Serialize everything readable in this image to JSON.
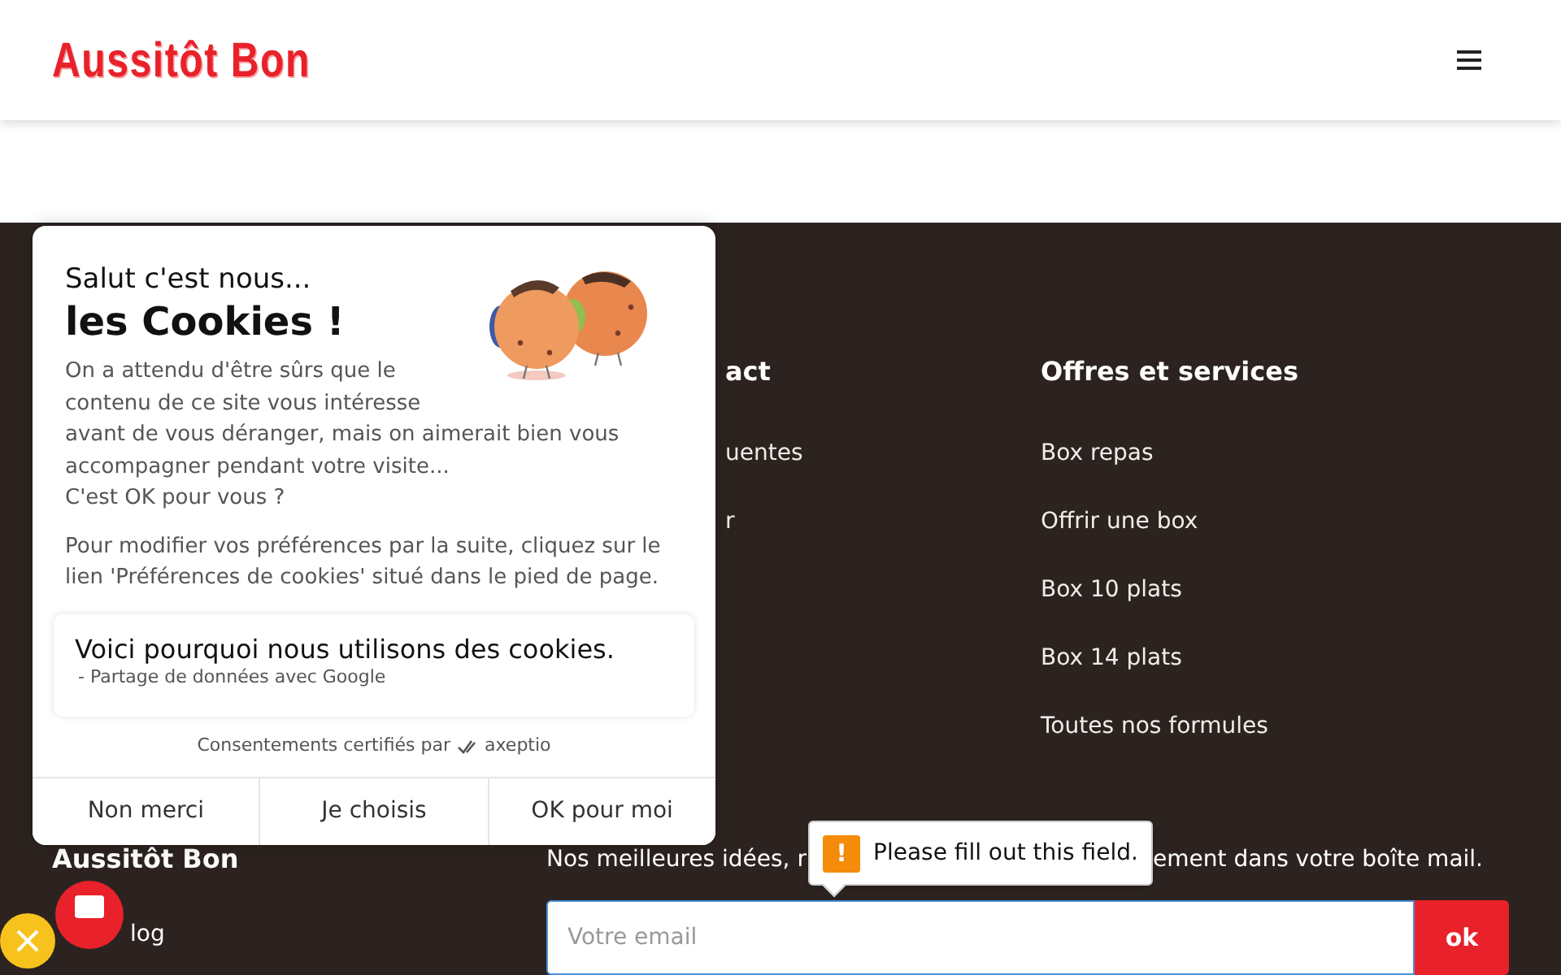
{
  "header": {
    "logo": "Aussitôt Bon"
  },
  "footer": {
    "columns": [
      {
        "heading": "act",
        "links": [
          "uentes",
          "r"
        ]
      },
      {
        "heading": "Offres et services",
        "links": [
          "Box repas",
          "Offrir une box",
          "Box 10 plats",
          "Box 14 plats",
          "Toutes nos formules"
        ]
      }
    ],
    "brand": "Aussitôt Bon",
    "brand_links": [
      "log"
    ],
    "newsletter": {
      "text_parts": [
        "Nos meilleures idées, r",
        "ement dans votre boîte mail."
      ],
      "placeholder": "Votre email",
      "button": "ok"
    }
  },
  "cookie_banner": {
    "greeting": "Salut c'est nous...",
    "title": "les Cookies !",
    "intro_lines": [
      "On a attendu d'être sûrs que le",
      "contenu de ce site vous intéresse",
      "avant de vous déranger, mais on aimerait bien vous",
      "accompagner pendant votre visite...",
      "C'est OK pour vous ?"
    ],
    "preferences_text": "Pour modifier vos préférences par la suite, cliquez sur le lien 'Préférences de cookies' situé dans le pied de page.",
    "purpose_card": {
      "title": "Voici pourquoi nous utilisons des cookies.",
      "items": [
        "- Partage de données avec Google"
      ]
    },
    "certified": "Consentements certifiés par",
    "certifier": "axeptio",
    "buttons": [
      "Non merci",
      "Je choisis",
      "OK pour moi"
    ]
  },
  "validation_tooltip": {
    "icon": "!",
    "message": "Please fill out this field."
  }
}
